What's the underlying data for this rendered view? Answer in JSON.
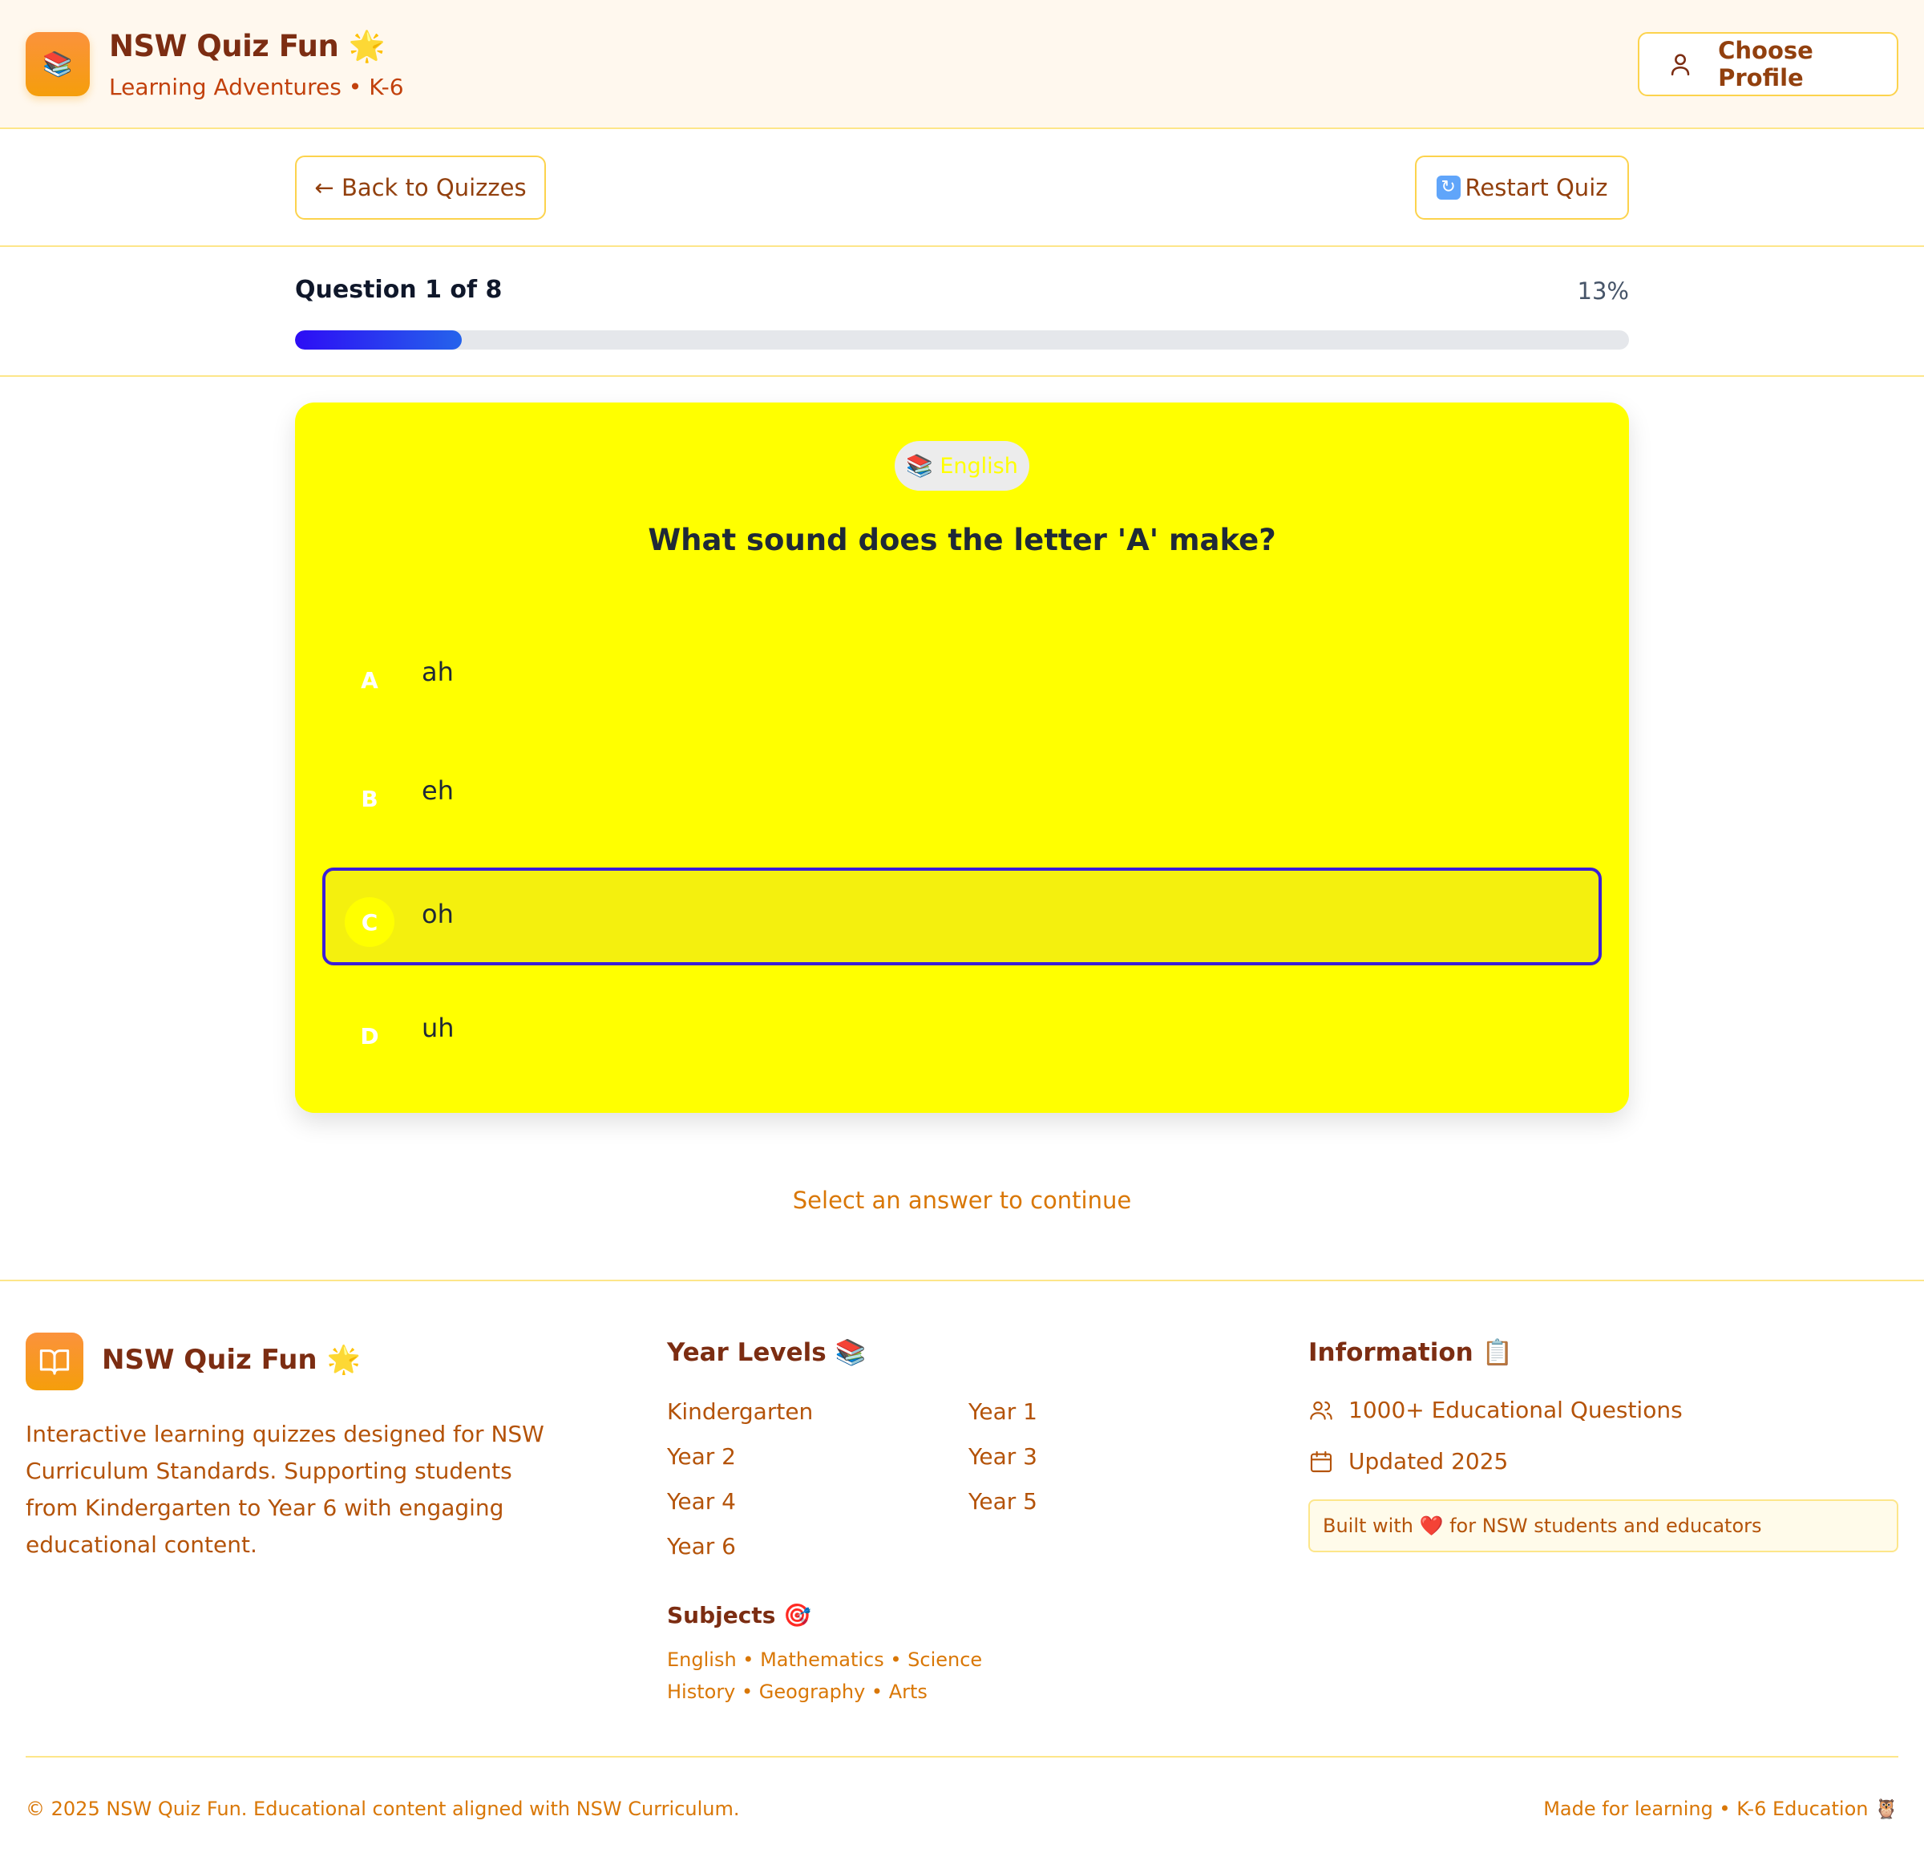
{
  "header": {
    "logo_emoji": "📚",
    "title": "NSW Quiz Fun 🌟",
    "subtitle": "Learning Adventures • K-6",
    "profile_button": "Choose Profile"
  },
  "nav": {
    "back_label": "← Back to Quizzes",
    "restart_label": "Restart Quiz"
  },
  "progress": {
    "question_label": "Question 1 of 8",
    "percent_label": "13%",
    "fraction": 0.125,
    "bar_color_start": "#2d0df5",
    "bar_color_end": "#2563eb"
  },
  "question": {
    "subject_pill": "📚 English",
    "text": "What sound does the letter 'A' make?",
    "card_color": "#ffff00",
    "options": [
      {
        "letter": "A",
        "text": "ah"
      },
      {
        "letter": "B",
        "text": "eh"
      },
      {
        "letter": "C",
        "text": "oh"
      },
      {
        "letter": "D",
        "text": "uh"
      }
    ],
    "selected_letter": "C",
    "selected_border_color": "#3b1ed8"
  },
  "hint": "Select an answer to continue",
  "footer": {
    "brand_title": "NSW Quiz Fun 🌟",
    "description": "Interactive learning quizzes designed for NSW Curriculum Standards. Supporting students from Kindergarten to Year 6 with engaging educational content.",
    "year_levels_heading": "Year Levels 📚",
    "year_levels": [
      "Kindergarten",
      "Year 1",
      "Year 2",
      "Year 3",
      "Year 4",
      "Year 5",
      "Year 6"
    ],
    "subjects_heading": "Subjects 🎯",
    "subjects_line1": "English • Mathematics • Science",
    "subjects_line2": "History • Geography • Arts",
    "info_heading": "Information 📋",
    "info_questions": "1000+ Educational Questions",
    "info_updated": "Updated 2025",
    "built_with": "Built with ❤️ for NSW students and educators",
    "copyright": "© 2025 NSW Quiz Fun. Educational content aligned with NSW Curriculum.",
    "made_for": "Made for learning • K-6 Education 🦉"
  }
}
